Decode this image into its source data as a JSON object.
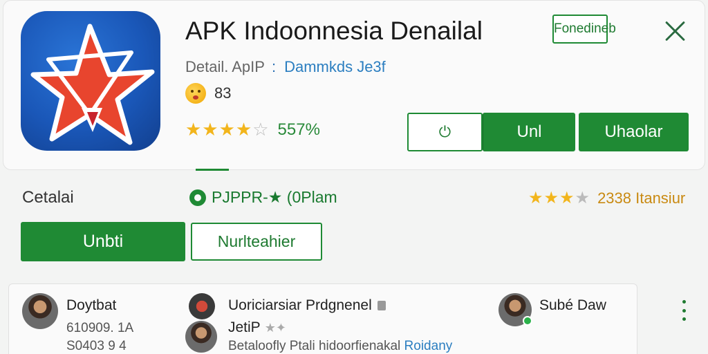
{
  "header": {
    "app_title": "APK Indoonnesia Denailal",
    "meta_left": "Detail. ApIP",
    "meta_sep": ":",
    "meta_link": "Dammkds Je3f",
    "emoji_count": "83",
    "rating_value": "557%",
    "rating_stars": 4.5,
    "fav_label": "Fonedineb",
    "power_label": "⏻",
    "btn_unl": "Unl",
    "btn_uhaolar": "Uhaolar"
  },
  "details": {
    "label": "Cetalai",
    "package": "PJPPR-★ (0Plam",
    "rating_stars": 3,
    "rating_text": "2338 Itansiur",
    "primary_button": "Unbti",
    "secondary_button": "Nurlteahier"
  },
  "reviews": [
    {
      "name": "Doytbat",
      "line1": "610909. 1A",
      "line2": "S0403 9 4"
    },
    {
      "name": "Uoriciarsiar Prdgnenel",
      "name2": "JetiP",
      "line2": "Betaloofly Ptali hidoorfienakal",
      "link": "Roidany"
    },
    {
      "name": "Subé Daw"
    }
  ],
  "colors": {
    "accent": "#1f8a34",
    "star": "#f2b51c",
    "link": "#2b7ec0"
  }
}
